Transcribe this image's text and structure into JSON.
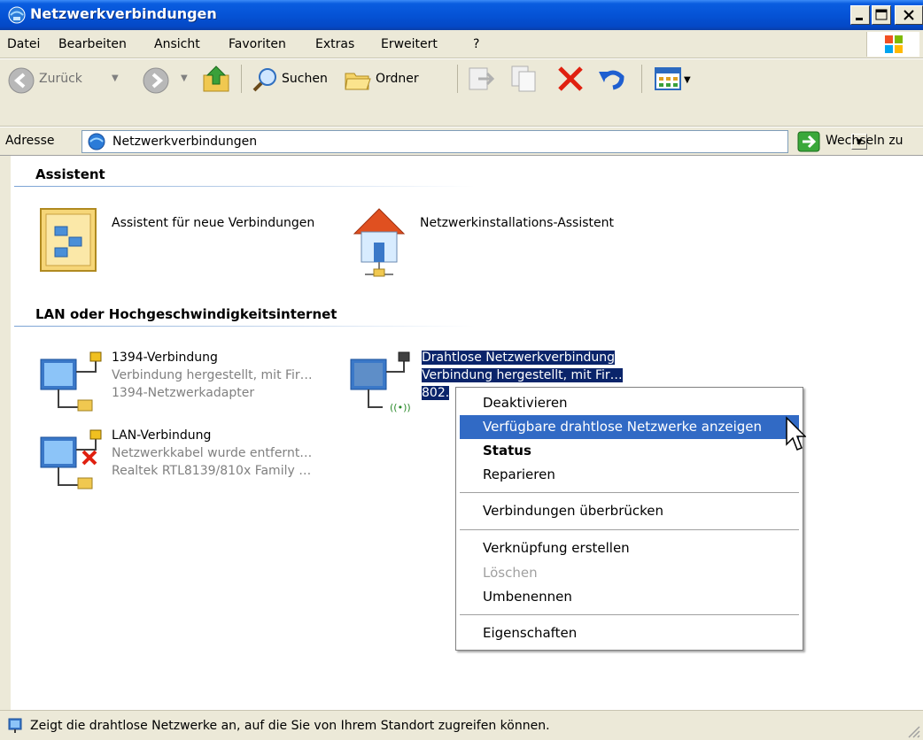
{
  "window": {
    "title": "Netzwerkverbindungen"
  },
  "menu": {
    "items": [
      "Datei",
      "Bearbeiten",
      "Ansicht",
      "Favoriten",
      "Extras",
      "Erweitert",
      "?"
    ]
  },
  "toolbar": {
    "back_label": "Zurück",
    "search_label": "Suchen",
    "folders_label": "Ordner"
  },
  "address": {
    "label": "Adresse",
    "value": "Netzwerkverbindungen",
    "go_label": "Wechseln zu"
  },
  "groups": {
    "assistant": {
      "title": "Assistent",
      "items": [
        {
          "label": "Assistent für neue Verbindungen"
        },
        {
          "label": "Netzwerkinstallations-Assistent"
        }
      ]
    },
    "lan": {
      "title": "LAN oder Hochgeschwindigkeitsinternet",
      "connections": [
        {
          "name": "1394-Verbindung",
          "status": "Verbindung hergestellt, mit Fir…",
          "device": "1394-Netzwerkadapter"
        },
        {
          "name": "Drahtlose Netzwerkverbindung",
          "status": "Verbindung hergestellt, mit Fir…",
          "device": "802."
        },
        {
          "name": "LAN-Verbindung",
          "status": "Netzwerkkabel wurde entfernt…",
          "device": "Realtek RTL8139/810x Family …"
        }
      ]
    }
  },
  "context_menu": {
    "items": [
      {
        "label": "Deaktivieren"
      },
      {
        "label": "Verfügbare drahtlose Netzwerke anzeigen"
      },
      {
        "label": "Status"
      },
      {
        "label": "Reparieren"
      },
      {
        "label": "Verbindungen überbrücken"
      },
      {
        "label": "Verknüpfung erstellen"
      },
      {
        "label": "Löschen"
      },
      {
        "label": "Umbenennen"
      },
      {
        "label": "Eigenschaften"
      }
    ]
  },
  "status_bar": {
    "text": "Zeigt die drahtlose Netzwerke an, auf die Sie von Ihrem Standort zugreifen können."
  },
  "colors": {
    "titlebar": "#0553d6",
    "chrome": "#ece9d8",
    "selection": "#0a246a",
    "menu_highlight": "#316ac5"
  }
}
